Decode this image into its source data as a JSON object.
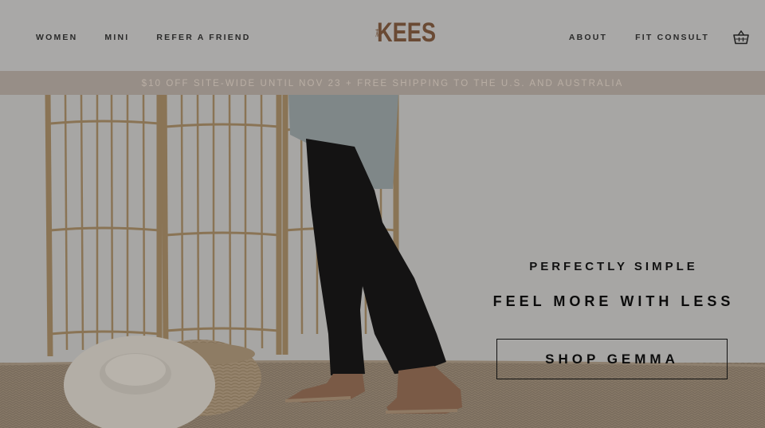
{
  "header": {
    "nav_left": [
      "WOMEN",
      "MINI",
      "REFER A FRIEND"
    ],
    "logo_text": "KEES",
    "nav_right": [
      "ABOUT",
      "FIT CONSULT"
    ],
    "cart_icon": "shopping-basket-icon"
  },
  "promo": {
    "text": "$10 OFF SITE-WIDE UNTIL NOV 23 + FREE SHIPPING TO THE U.S. AND AUSTRALIA"
  },
  "hero": {
    "eyebrow": "PERFECTLY SIMPLE",
    "headline": "FEEL MORE WITH LESS",
    "cta_label": "SHOP GEMMA"
  },
  "colors": {
    "logo": "#6a4a34",
    "header_bg": "#a9a8a7",
    "promo_bg": "#978e87",
    "promo_text": "#b9aea4",
    "text_dark": "#111111"
  }
}
